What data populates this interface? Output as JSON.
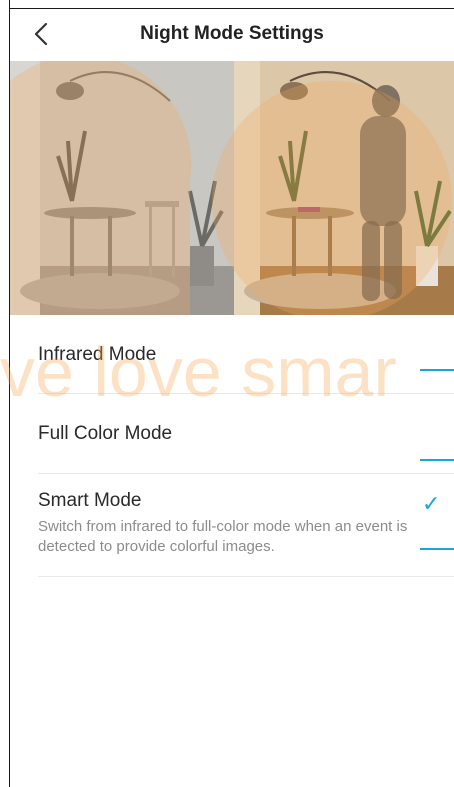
{
  "header": {
    "title": "Night Mode Settings"
  },
  "options": [
    {
      "label": "Infrared Mode",
      "description": "",
      "selected": false
    },
    {
      "label": "Full Color Mode",
      "description": "",
      "selected": false
    },
    {
      "label": "Smart Mode",
      "description": "Switch from infrared to full-color mode when an event is detected to provide colorful images.",
      "selected": true
    }
  ],
  "watermark": "ve love smar",
  "colors": {
    "accent": "#1aa6d6",
    "watermark": "#f7aa5a"
  }
}
